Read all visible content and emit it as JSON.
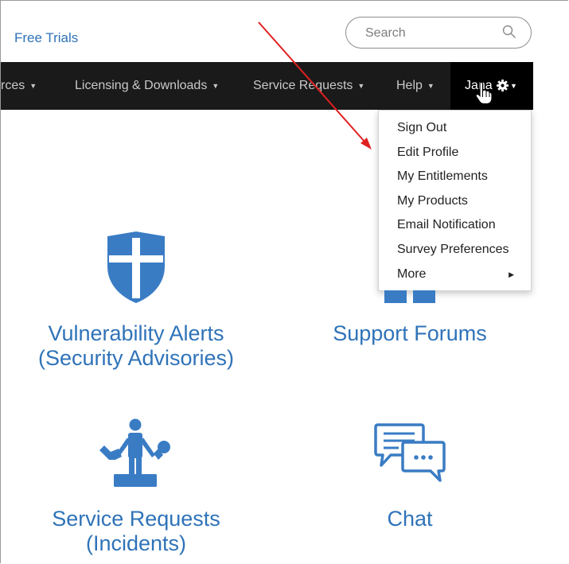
{
  "header": {
    "free_trials": "Free Trials",
    "search_placeholder": "Search"
  },
  "nav": {
    "items": [
      {
        "label": "rces"
      },
      {
        "label": "Licensing & Downloads"
      },
      {
        "label": "Service Requests"
      },
      {
        "label": "Help"
      }
    ],
    "user": {
      "label": "Jana"
    }
  },
  "dropdown": {
    "items": [
      "Sign Out",
      "Edit Profile",
      "My Entitlements",
      "My Products",
      "Email Notification",
      "Survey Preferences",
      "More"
    ]
  },
  "tiles": [
    {
      "title_line1": "Vulnerability Alerts",
      "title_line2": "(Security Advisories)",
      "icon": "shield-cross-icon"
    },
    {
      "title_line1": "Support Forums",
      "title_line2": "",
      "icon": "forums-icon"
    },
    {
      "title_line1": "Service Requests",
      "title_line2": "(Incidents)",
      "icon": "technician-icon"
    },
    {
      "title_line1": "Chat",
      "title_line2": "",
      "icon": "chat-bubbles-icon"
    }
  ],
  "colors": {
    "accent": "#2f73b8",
    "nav_bg": "#1a1a1a",
    "annotation": "#e02020"
  }
}
